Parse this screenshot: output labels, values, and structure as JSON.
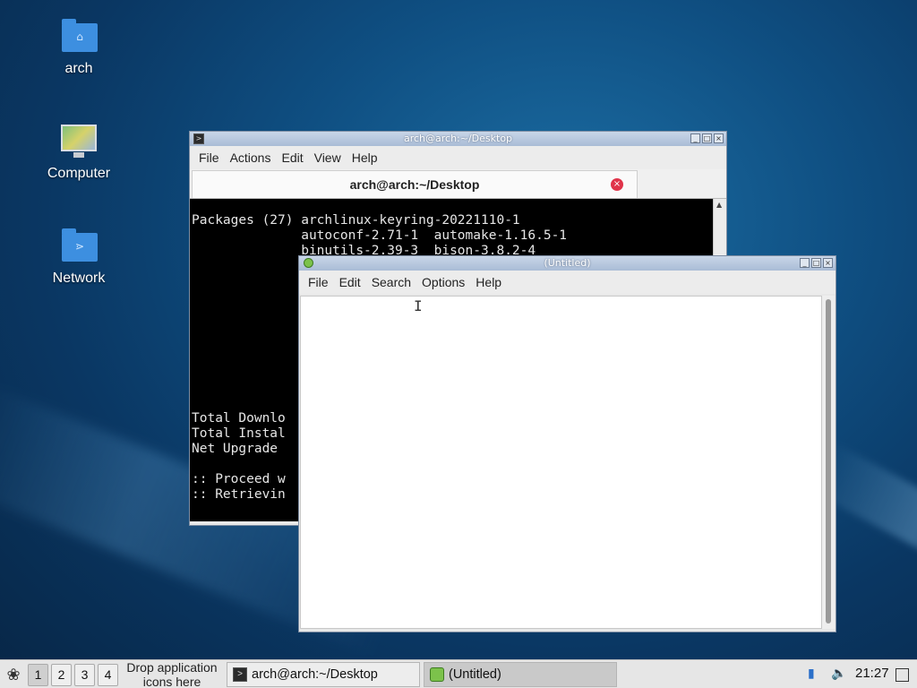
{
  "desktop": {
    "icons": [
      {
        "label": "arch",
        "icon": "home-folder-icon"
      },
      {
        "label": "Computer",
        "icon": "computer-icon"
      },
      {
        "label": "Network",
        "icon": "network-folder-icon"
      }
    ]
  },
  "terminal": {
    "title": "arch@arch:~/Desktop",
    "menu": [
      "File",
      "Actions",
      "Edit",
      "View",
      "Help"
    ],
    "tab_label": "arch@arch:~/Desktop",
    "lines": [
      "Packages (27) archlinux-keyring-20221110-1",
      "              autoconf-2.71-1  automake-1.16.5-1",
      "              binutils-2.39-3  bison-3.8.2-4",
      "",
      "",
      "",
      "",
      "",
      "",
      "",
      "",
      "",
      "",
      "Total Downlo",
      "Total Instal",
      "Net Upgrade",
      "",
      ":: Proceed w",
      ":: Retrievin"
    ]
  },
  "editor": {
    "title": "(Untitled)",
    "menu": [
      "File",
      "Edit",
      "Search",
      "Options",
      "Help"
    ],
    "content": ""
  },
  "taskbar": {
    "workspaces": [
      "1",
      "2",
      "3",
      "4"
    ],
    "active_workspace": "1",
    "drop_hint_line1": "Drop application",
    "drop_hint_line2": "icons here",
    "tasks": [
      {
        "label": "arch@arch:~/Desktop",
        "icon": "terminal-icon"
      },
      {
        "label": "(Untitled)",
        "icon": "text-editor-icon"
      }
    ],
    "clock": "21:27"
  },
  "colors": {
    "desktop_bg": "#0f4f82",
    "titlebar": "#a9bcd6",
    "terminal_bg": "#000000",
    "tab_close": "#e0344a",
    "folder": "#3d8fe0"
  }
}
